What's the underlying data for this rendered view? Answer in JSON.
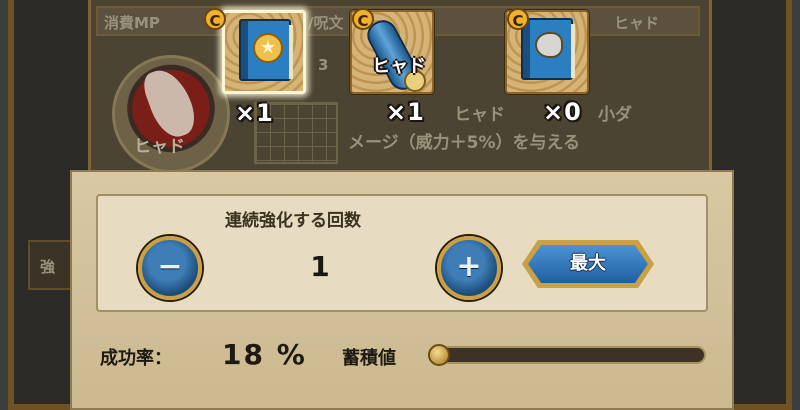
{
  "background": {
    "mp_label": "消費MP",
    "mp_suffix": "/呪文",
    "top_right_text": "ヒャド",
    "grid_number": "3",
    "medallion_label": "ヒャド",
    "desc_line1": "ヒャド",
    "desc_line1_right": "小ダ",
    "desc_line2": "メージ（威力＋5%）を与える",
    "left_tab_text": "強"
  },
  "items": [
    {
      "badge": "C",
      "icon": "blue-book-star-icon",
      "count": "×1",
      "selected": true
    },
    {
      "badge": "C",
      "icon": "blue-scroll-icon",
      "label": "ヒャド",
      "count": "×1",
      "selected": false
    },
    {
      "badge": "C",
      "icon": "blue-book-ice-icon",
      "count": "×0",
      "selected": false
    }
  ],
  "dialog": {
    "title": "連続強化する回数",
    "minus_symbol": "−",
    "plus_symbol": "+",
    "count_value": "1",
    "max_label": "最大",
    "success_rate_label": "成功率：",
    "success_rate_value": "18 %",
    "accumulation_label": "蓄積値",
    "accumulation_fraction": 0.0
  },
  "colors": {
    "frame_gold": "#c9a044",
    "button_blue": "#1f5fa0",
    "parchment": "#e7dcc2"
  }
}
